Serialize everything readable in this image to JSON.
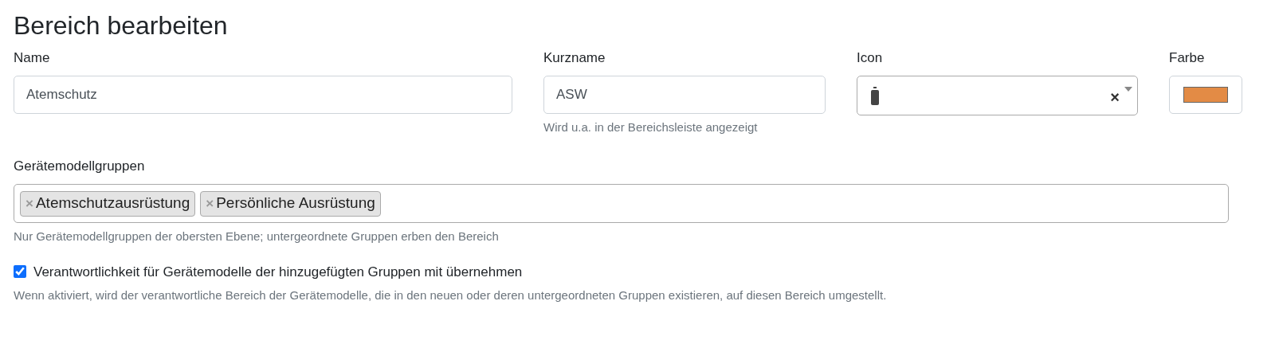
{
  "title": "Bereich bearbeiten",
  "name_field": {
    "label": "Name",
    "value": "Atemschutz"
  },
  "short_name_field": {
    "label": "Kurzname",
    "value": "ASW",
    "help": "Wird u.a. in der Bereichsleiste angezeigt"
  },
  "icon_field": {
    "label": "Icon",
    "clear": "×"
  },
  "color_field": {
    "label": "Farbe",
    "color": "#e38b45"
  },
  "groups_field": {
    "label": "Gerätemodellgruppen",
    "tags": [
      {
        "remove": "×",
        "label": "Atemschutzausrüstung"
      },
      {
        "remove": "×",
        "label": "Persönliche Ausrüstung"
      }
    ],
    "help": "Nur Gerätemodellgruppen der obersten Ebene; untergeordnete Gruppen erben den Bereich"
  },
  "responsibility": {
    "label": "Verantwortlichkeit für Gerätemodelle der hinzugefügten Gruppen mit übernehmen",
    "checked": true,
    "help": "Wenn aktiviert, wird der verantwortliche Bereich der Gerätemodelle, die in den neuen oder deren untergeordneten Gruppen existieren, auf diesen Bereich umgestellt."
  }
}
